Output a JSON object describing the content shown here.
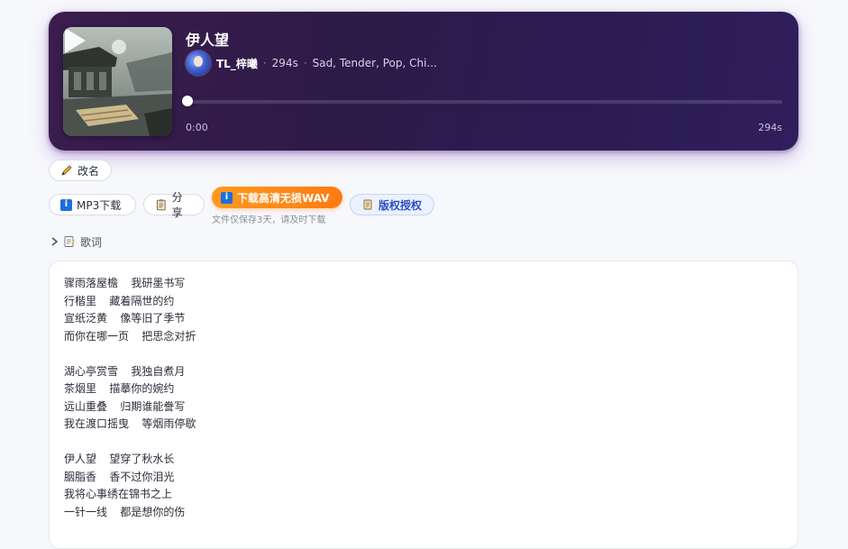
{
  "player": {
    "title": "伊人望",
    "artist": "TL_梓曦",
    "duration": "294s",
    "tags": "Sad, Tender, Pop, Chi...",
    "current_time": "0:00",
    "total_time": "294s",
    "progress_fraction": 0.0
  },
  "actions": {
    "rename_label": "改名",
    "mp3_label": "MP3下载",
    "share_label": "分享",
    "wav_label": "下载高清无损WAV",
    "wav_note": "文件仅保存3天，请及时下载",
    "license_label": "版权授权"
  },
  "lyrics": {
    "toggle_label": "歌词",
    "text": "骤雨落屋檐  我研墨书写\n行楷里  藏着隔世的约\n宣纸泛黄  像等旧了季节\n而你在哪一页  把思念对折\n\n湖心亭赏雪  我独自煮月\n茶烟里  描摹你的婉约\n远山重叠  归期谁能誊写\n我在渡口摇曳  等烟雨停歇\n\n伊人望  望穿了秋水长\n胭脂香  香不过你泪光\n我将心事绣在锦书之上\n一针一线  都是想你的伤"
  },
  "icons": {
    "play": "play-icon",
    "rename": "pencil-icon",
    "mp3": "info-icon",
    "share": "clipboard-icon",
    "wav": "info-icon",
    "license": "scroll-icon",
    "lyrics_chevron": "chevron-right-icon",
    "lyrics": "memo-icon"
  },
  "colors": {
    "player_bg": "#2d1a47",
    "wav_button": "#ff8a18",
    "license_text": "#2c4fc4",
    "info_blue": "#1d6fe0"
  }
}
